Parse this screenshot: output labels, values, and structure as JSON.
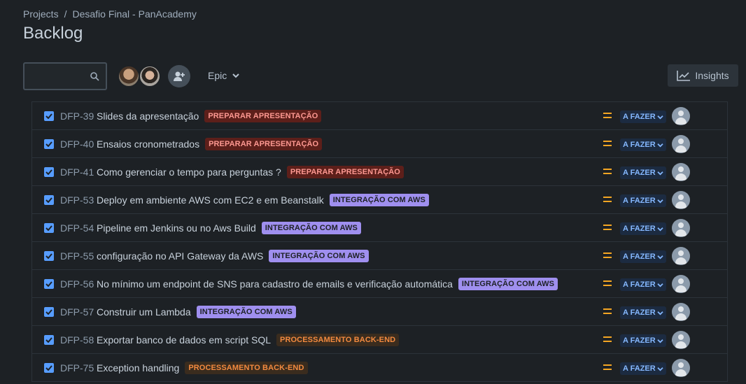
{
  "breadcrumb": {
    "projects": "Projects",
    "separator": "/",
    "project": "Desafio Final - PanAcademy"
  },
  "page_title": "Backlog",
  "toolbar": {
    "search_placeholder": "",
    "epic_label": "Epic",
    "insights_label": "Insights"
  },
  "issues": [
    {
      "key": "DFP-39",
      "summary": "Slides da apresentação",
      "epic": "PREPARAR APRESENTAÇÃO",
      "epic_color": "red",
      "status": "A FAZER"
    },
    {
      "key": "DFP-40",
      "summary": "Ensaios cronometrados",
      "epic": "PREPARAR APRESENTAÇÃO",
      "epic_color": "red",
      "status": "A FAZER"
    },
    {
      "key": "DFP-41",
      "summary": "Como gerenciar o tempo para perguntas ?",
      "epic": "PREPARAR APRESENTAÇÃO",
      "epic_color": "red",
      "status": "A FAZER"
    },
    {
      "key": "DFP-53",
      "summary": "Deploy em ambiente AWS com EC2 e em Beanstalk",
      "epic": "INTEGRAÇÃO COM AWS",
      "epic_color": "purple",
      "status": "A FAZER"
    },
    {
      "key": "DFP-54",
      "summary": "Pipeline em Jenkins ou no Aws Build",
      "epic": "INTEGRAÇÃO COM AWS",
      "epic_color": "purple",
      "status": "A FAZER"
    },
    {
      "key": "DFP-55",
      "summary": "configuração no API Gateway da AWS",
      "epic": "INTEGRAÇÃO COM AWS",
      "epic_color": "purple",
      "status": "A FAZER"
    },
    {
      "key": "DFP-56",
      "summary": "No mínimo um endpoint de SNS para cadastro de emails e verificação automática",
      "epic": "INTEGRAÇÃO COM AWS",
      "epic_color": "purple",
      "status": "A FAZER"
    },
    {
      "key": "DFP-57",
      "summary": "Construir um Lambda",
      "epic": "INTEGRAÇÃO COM AWS",
      "epic_color": "purple",
      "status": "A FAZER"
    },
    {
      "key": "DFP-58",
      "summary": "Exportar banco de dados em script SQL",
      "epic": "PROCESSAMENTO BACK-END",
      "epic_color": "orange",
      "status": "A FAZER"
    },
    {
      "key": "DFP-75",
      "summary": "Exception handling",
      "epic": "PROCESSAMENTO BACK-END",
      "epic_color": "orange",
      "status": "A FAZER"
    }
  ],
  "colors": {
    "background": "#1d2125",
    "accent": "#579dff",
    "priority_medium": "#f5a623",
    "status_todo": "#85b8ff"
  }
}
